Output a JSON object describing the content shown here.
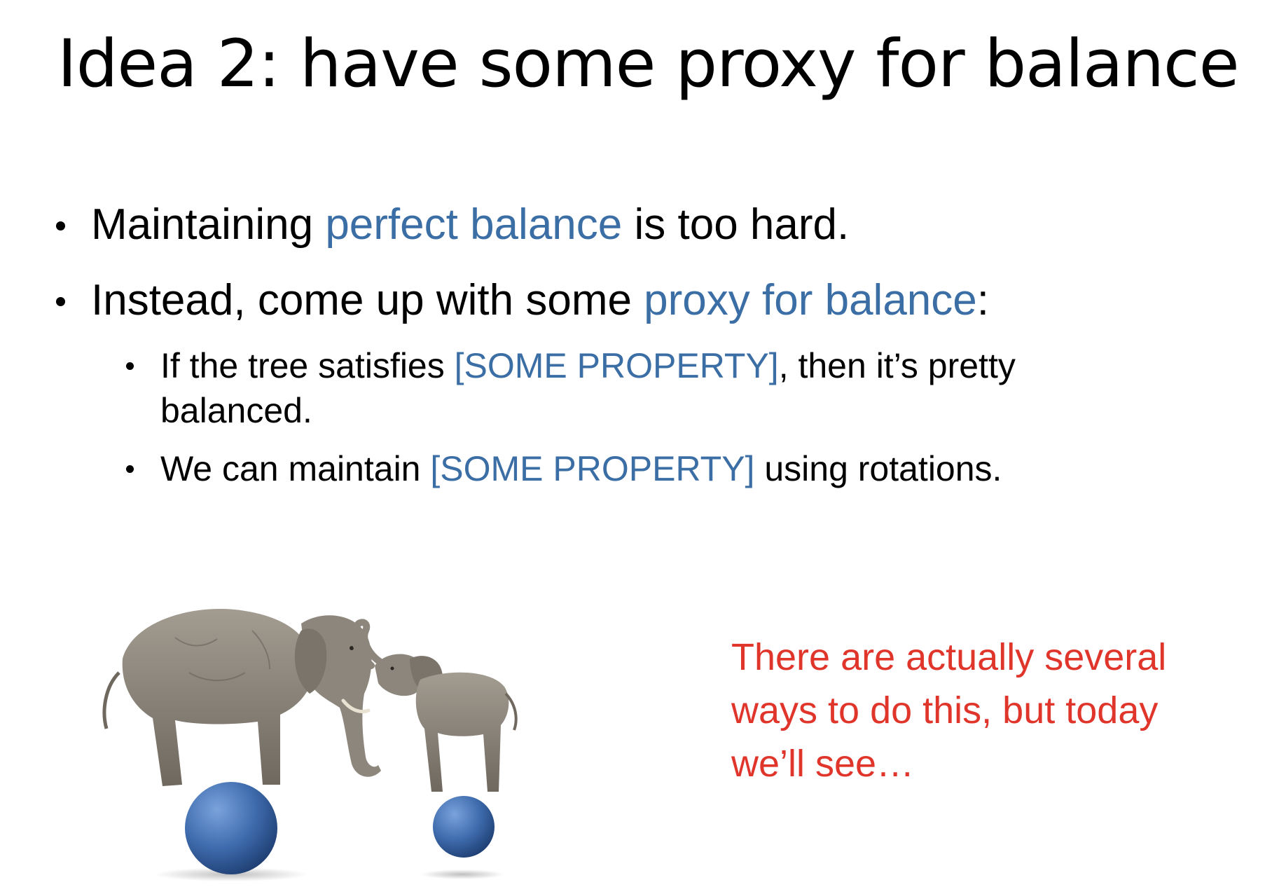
{
  "slide": {
    "title": "Idea 2: have some proxy for balance",
    "bullets": [
      {
        "pre": "Maintaining ",
        "highlight": "perfect balance",
        "post": " is too hard."
      },
      {
        "pre": "Instead, come up with some ",
        "highlight": "proxy for balance",
        "post": ":"
      }
    ],
    "sub_bullets": [
      {
        "pre": "If the tree satisfies ",
        "highlight": "[SOME PROPERTY]",
        "post": ", then it’s pretty balanced."
      },
      {
        "pre": "We can maintain ",
        "highlight": "[SOME PROPERTY]",
        "post": " using rotations."
      }
    ],
    "note_lines": [
      "There are actually several",
      "ways to do this, but today",
      "we’ll see…"
    ],
    "image": {
      "description_icon": "elephants-balancing-on-balls-icon"
    },
    "colors": {
      "accent": "#3b6ea5",
      "note": "#e0352b",
      "ball": "#3f6cae",
      "elephant": "#8d867c"
    }
  }
}
